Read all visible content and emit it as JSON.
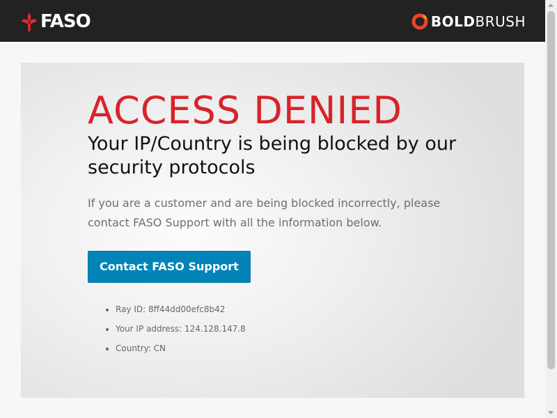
{
  "header": {
    "left_logo": {
      "text": "FASO",
      "icon": "faso-fleur-icon",
      "color": "#e02d2d"
    },
    "right_logo": {
      "bold": "BOLD",
      "light": "BRUSH",
      "icon": "boldbrush-ring-icon",
      "color": "#e8462b"
    }
  },
  "main": {
    "title": "ACCESS DENIED",
    "subtitle": "Your IP/Country is being blocked by our security protocols",
    "message": "If you are a customer and are being blocked incorrectly, please contact FASO Support with all the information below.",
    "button_label": "Contact FASO Support",
    "info": [
      "Ray ID: 8ff44dd00efc8b42",
      "Your IP address: 124.128.147.8",
      "Country: CN"
    ]
  },
  "colors": {
    "header_bg": "#222222",
    "title": "#d8232a",
    "button": "#0284b8"
  }
}
